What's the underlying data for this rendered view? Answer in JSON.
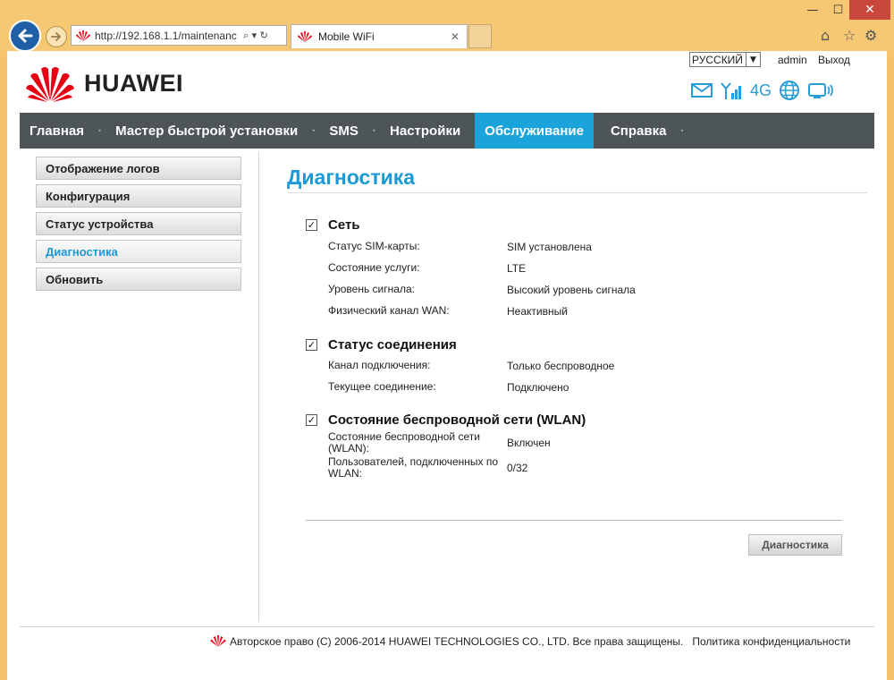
{
  "browser": {
    "url": "http://192.168.1.1/maintenanc",
    "tab_title": "Mobile WiFi",
    "tab_close": "✕",
    "url_controls": "⌕ ▾ ↻",
    "window": {
      "minimize": "—",
      "maximize": "☐",
      "close": "✕"
    },
    "tools": {
      "home": "⌂",
      "favorites": "☆",
      "settings": "⚙"
    }
  },
  "header": {
    "brand": "HUAWEI",
    "language": "РУССКИЙ",
    "language_arrow": "▼",
    "user": "admin",
    "logout": "Выход",
    "network": "4G"
  },
  "nav": {
    "items": [
      {
        "label": "Главная"
      },
      {
        "label": "Мастер быстрой установки"
      },
      {
        "label": "SMS"
      },
      {
        "label": "Настройки"
      },
      {
        "label": "Обслуживание",
        "active": true
      },
      {
        "label": "Справка"
      }
    ],
    "separator": "•"
  },
  "sidebar": {
    "items": [
      {
        "label": "Отображение логов"
      },
      {
        "label": "Конфигурация"
      },
      {
        "label": "Статус устройства"
      },
      {
        "label": "Диагностика",
        "active": true
      },
      {
        "label": "Обновить"
      }
    ]
  },
  "main": {
    "title": "Диагностика",
    "checkmark": "✓",
    "network": {
      "title": "Сеть",
      "rows": [
        {
          "label": "Статус SIM-карты:",
          "value": "SIM установлена"
        },
        {
          "label": "Состояние услуги:",
          "value": "LTE"
        },
        {
          "label": "Уровень сигнала:",
          "value": "Высокий уровень сигнала"
        },
        {
          "label": "Физический канал WAN:",
          "value": "Неактивный"
        }
      ]
    },
    "connection": {
      "title": "Статус соединения",
      "rows": [
        {
          "label": "Канал подключения:",
          "value": "Только беспроводное"
        },
        {
          "label": "Текущее соединение:",
          "value": "Подключено"
        }
      ]
    },
    "wlan": {
      "title": "Состояние беспроводной сети (WLAN)",
      "rows": [
        {
          "label": "Состояние беспроводной сети (WLAN):",
          "value": "Включен"
        },
        {
          "label": "Пользователей, подключенных по WLAN:",
          "value": "0/32"
        }
      ]
    },
    "button": "Диагностика"
  },
  "footer": {
    "copyright": "Авторское право (C) 2006-2014 HUAWEI TECHNOLOGIES CO., LTD. Все права защищены.",
    "policy": "Политика конфиденциальности"
  },
  "colors": {
    "accent": "#1ba3dc",
    "nav_bg": "#4e5558",
    "brand_red": "#e60012",
    "chrome": "#f7c873"
  }
}
